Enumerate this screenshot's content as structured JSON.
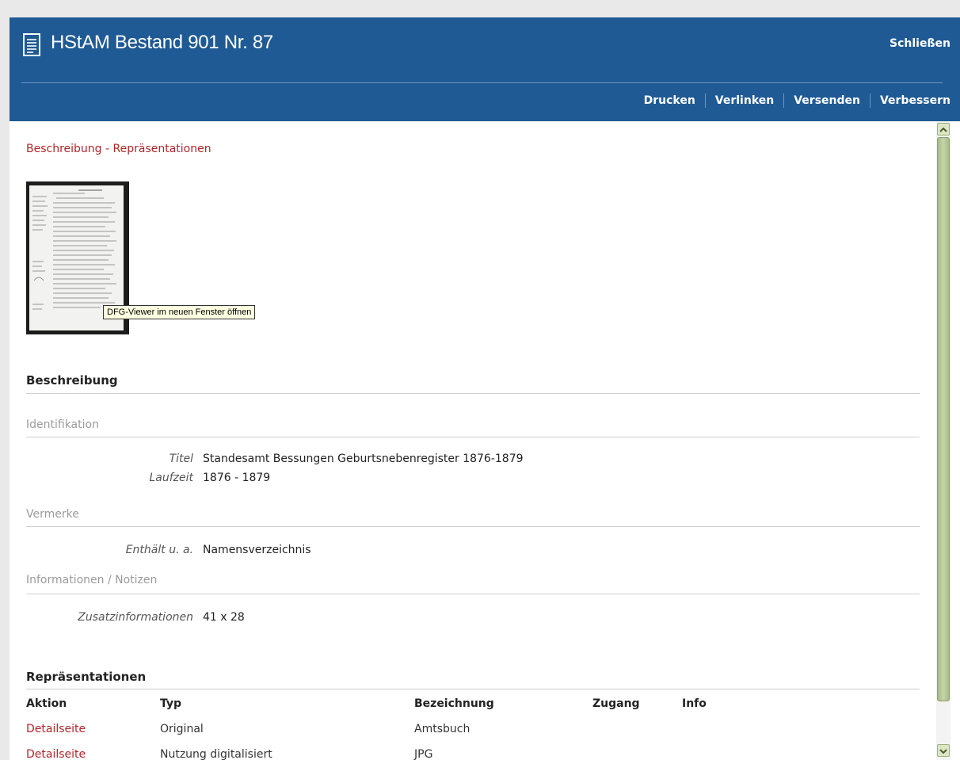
{
  "header": {
    "title": "HStAM Bestand 901 Nr. 87",
    "close_label": "Schließen",
    "actions": [
      "Drucken",
      "Verlinken",
      "Versenden",
      "Verbessern"
    ]
  },
  "breadcrumb": {
    "link1": "Beschreibung",
    "separator": " - ",
    "link2": "Repräsentationen"
  },
  "thumbnail": {
    "tooltip": "DFG-Viewer im neuen Fenster öffnen"
  },
  "beschreibung": {
    "heading": "Beschreibung",
    "groups": [
      {
        "title": "Identifikation",
        "fields": [
          {
            "label": "Titel",
            "value": "Standesamt Bessungen Geburtsnebenregister 1876-1879"
          },
          {
            "label": "Laufzeit",
            "value": "1876 - 1879"
          }
        ]
      },
      {
        "title": "Vermerke",
        "fields": [
          {
            "label": "Enthält u. a.",
            "value": "Namensverzeichnis"
          }
        ]
      },
      {
        "title": "Informationen / Notizen",
        "fields": [
          {
            "label": "Zusatzinformationen",
            "value": "41 x 28"
          }
        ]
      }
    ]
  },
  "repraesentationen": {
    "heading": "Repräsentationen",
    "columns": [
      "Aktion",
      "Typ",
      "Bezeichnung",
      "Zugang",
      "Info"
    ],
    "rows": [
      {
        "aktion": "Detailseite",
        "typ": "Original",
        "bezeichnung": "Amtsbuch",
        "zugang": "",
        "info": ""
      },
      {
        "aktion": "Detailseite",
        "typ": "Nutzung digitalisiert",
        "bezeichnung": "JPG",
        "zugang": "",
        "info": ""
      }
    ]
  },
  "colors": {
    "header_bg": "#1f5a94",
    "link": "#b0262b",
    "scroll_thumb": "#a7bb86"
  }
}
